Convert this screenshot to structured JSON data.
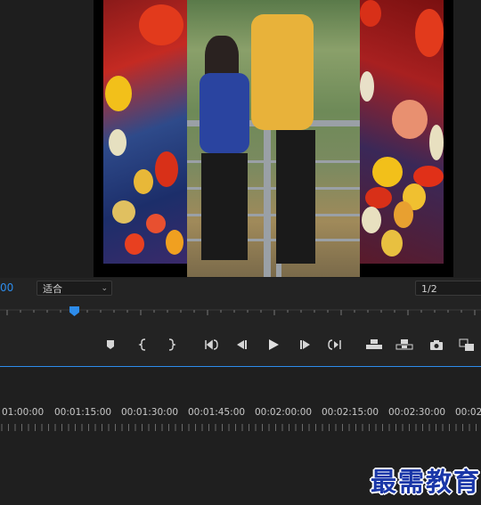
{
  "monitor": {
    "timecode": "00",
    "fit_label": "适合",
    "resolution_label": "1/2"
  },
  "transport": {
    "buttons": [
      "add-marker",
      "mark-in",
      "mark-out",
      "go-to-in",
      "step-back",
      "play",
      "step-forward",
      "go-to-out",
      "insert",
      "overwrite",
      "export-frame",
      "button-editor"
    ]
  },
  "timeline": {
    "timecodes": [
      "01:00:00",
      "00:01:15:00",
      "00:01:30:00",
      "00:01:45:00",
      "00:02:00:00",
      "00:02:15:00",
      "00:02:30:00",
      "00:02"
    ]
  },
  "watermark": {
    "text": "最需教育"
  },
  "colors": {
    "accent": "#2d8ceb",
    "background": "#232323"
  }
}
